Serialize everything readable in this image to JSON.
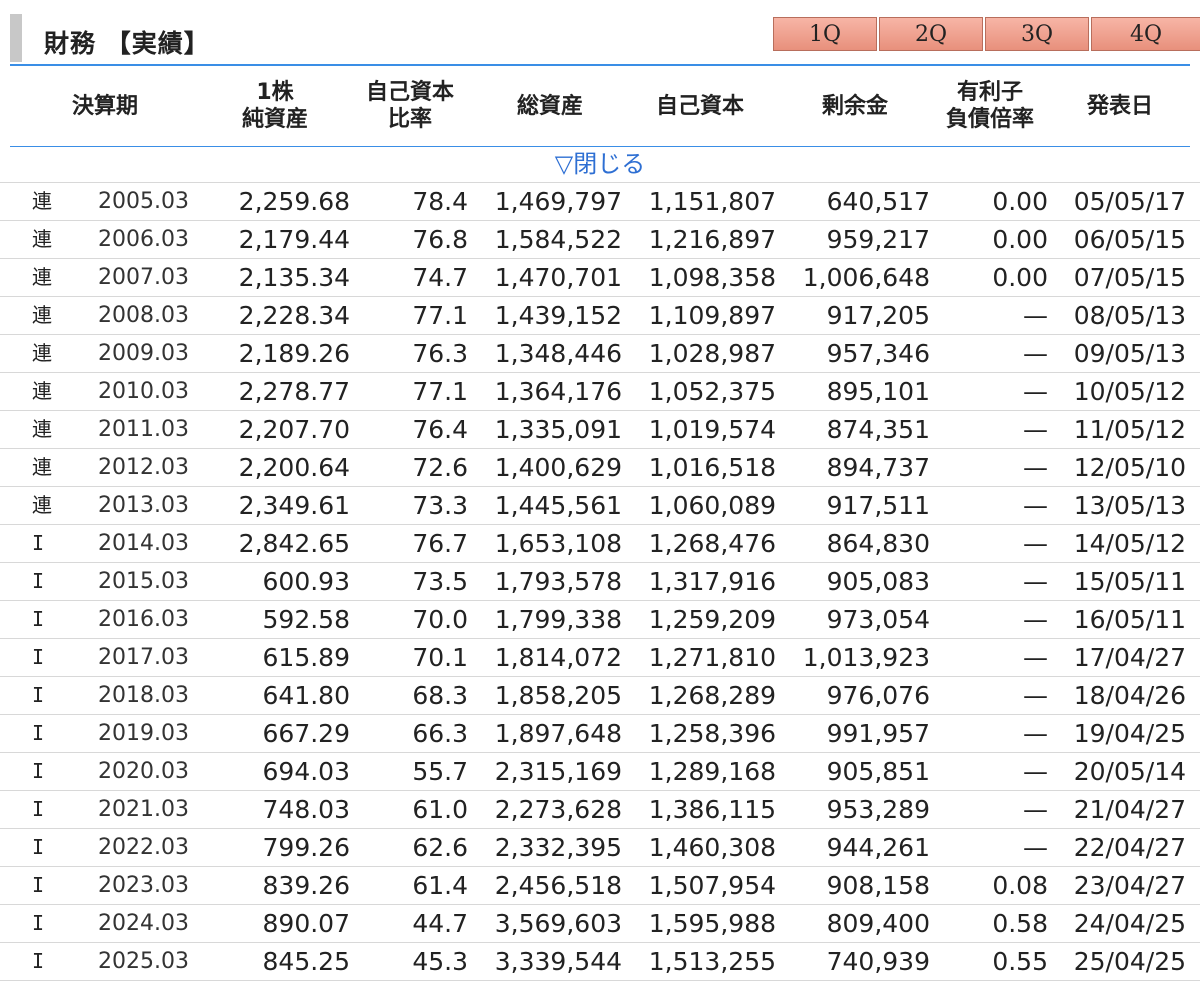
{
  "title": "財務 【実績】",
  "quarter_tabs": [
    "1Q",
    "2Q",
    "3Q",
    "4Q"
  ],
  "headers": {
    "period": "決算期",
    "bps": [
      "1株",
      "純資産"
    ],
    "equity_ratio": [
      "自己資本",
      "比率"
    ],
    "total_assets": "総資産",
    "equity": "自己資本",
    "surplus": "剰余金",
    "debt_ratio": [
      "有利子",
      "負債倍率"
    ],
    "announce": "発表日"
  },
  "close_link": "▽閉じる",
  "rows": [
    [
      "連",
      "2005.03",
      "2,259.68",
      "78.4",
      "1,469,797",
      "1,151,807",
      "640,517",
      "0.00",
      "05/05/17"
    ],
    [
      "連",
      "2006.03",
      "2,179.44",
      "76.8",
      "1,584,522",
      "1,216,897",
      "959,217",
      "0.00",
      "06/05/15"
    ],
    [
      "連",
      "2007.03",
      "2,135.34",
      "74.7",
      "1,470,701",
      "1,098,358",
      "1,006,648",
      "0.00",
      "07/05/15"
    ],
    [
      "連",
      "2008.03",
      "2,228.34",
      "77.1",
      "1,439,152",
      "1,109,897",
      "917,205",
      "—",
      "08/05/13"
    ],
    [
      "連",
      "2009.03",
      "2,189.26",
      "76.3",
      "1,348,446",
      "1,028,987",
      "957,346",
      "—",
      "09/05/13"
    ],
    [
      "連",
      "2010.03",
      "2,278.77",
      "77.1",
      "1,364,176",
      "1,052,375",
      "895,101",
      "—",
      "10/05/12"
    ],
    [
      "連",
      "2011.03",
      "2,207.70",
      "76.4",
      "1,335,091",
      "1,019,574",
      "874,351",
      "—",
      "11/05/12"
    ],
    [
      "連",
      "2012.03",
      "2,200.64",
      "72.6",
      "1,400,629",
      "1,016,518",
      "894,737",
      "—",
      "12/05/10"
    ],
    [
      "連",
      "2013.03",
      "2,349.61",
      "73.3",
      "1,445,561",
      "1,060,089",
      "917,511",
      "—",
      "13/05/13"
    ],
    [
      "I",
      "2014.03",
      "2,842.65",
      "76.7",
      "1,653,108",
      "1,268,476",
      "864,830",
      "—",
      "14/05/12"
    ],
    [
      "I",
      "2015.03",
      "600.93",
      "73.5",
      "1,793,578",
      "1,317,916",
      "905,083",
      "—",
      "15/05/11"
    ],
    [
      "I",
      "2016.03",
      "592.58",
      "70.0",
      "1,799,338",
      "1,259,209",
      "973,054",
      "—",
      "16/05/11"
    ],
    [
      "I",
      "2017.03",
      "615.89",
      "70.1",
      "1,814,072",
      "1,271,810",
      "1,013,923",
      "—",
      "17/04/27"
    ],
    [
      "I",
      "2018.03",
      "641.80",
      "68.3",
      "1,858,205",
      "1,268,289",
      "976,076",
      "—",
      "18/04/26"
    ],
    [
      "I",
      "2019.03",
      "667.29",
      "66.3",
      "1,897,648",
      "1,258,396",
      "991,957",
      "—",
      "19/04/25"
    ],
    [
      "I",
      "2020.03",
      "694.03",
      "55.7",
      "2,315,169",
      "1,289,168",
      "905,851",
      "—",
      "20/05/14"
    ],
    [
      "I",
      "2021.03",
      "748.03",
      "61.0",
      "2,273,628",
      "1,386,115",
      "953,289",
      "—",
      "21/04/27"
    ],
    [
      "I",
      "2022.03",
      "799.26",
      "62.6",
      "2,332,395",
      "1,460,308",
      "944,261",
      "—",
      "22/04/27"
    ],
    [
      "I",
      "2023.03",
      "839.26",
      "61.4",
      "2,456,518",
      "1,507,954",
      "908,158",
      "0.08",
      "23/04/27"
    ],
    [
      "I",
      "2024.03",
      "890.07",
      "44.7",
      "3,569,603",
      "1,595,988",
      "809,400",
      "0.58",
      "24/04/25"
    ],
    [
      "I",
      "2025.03",
      "845.25",
      "45.3",
      "3,339,544",
      "1,513,255",
      "740,939",
      "0.55",
      "25/04/25"
    ]
  ]
}
